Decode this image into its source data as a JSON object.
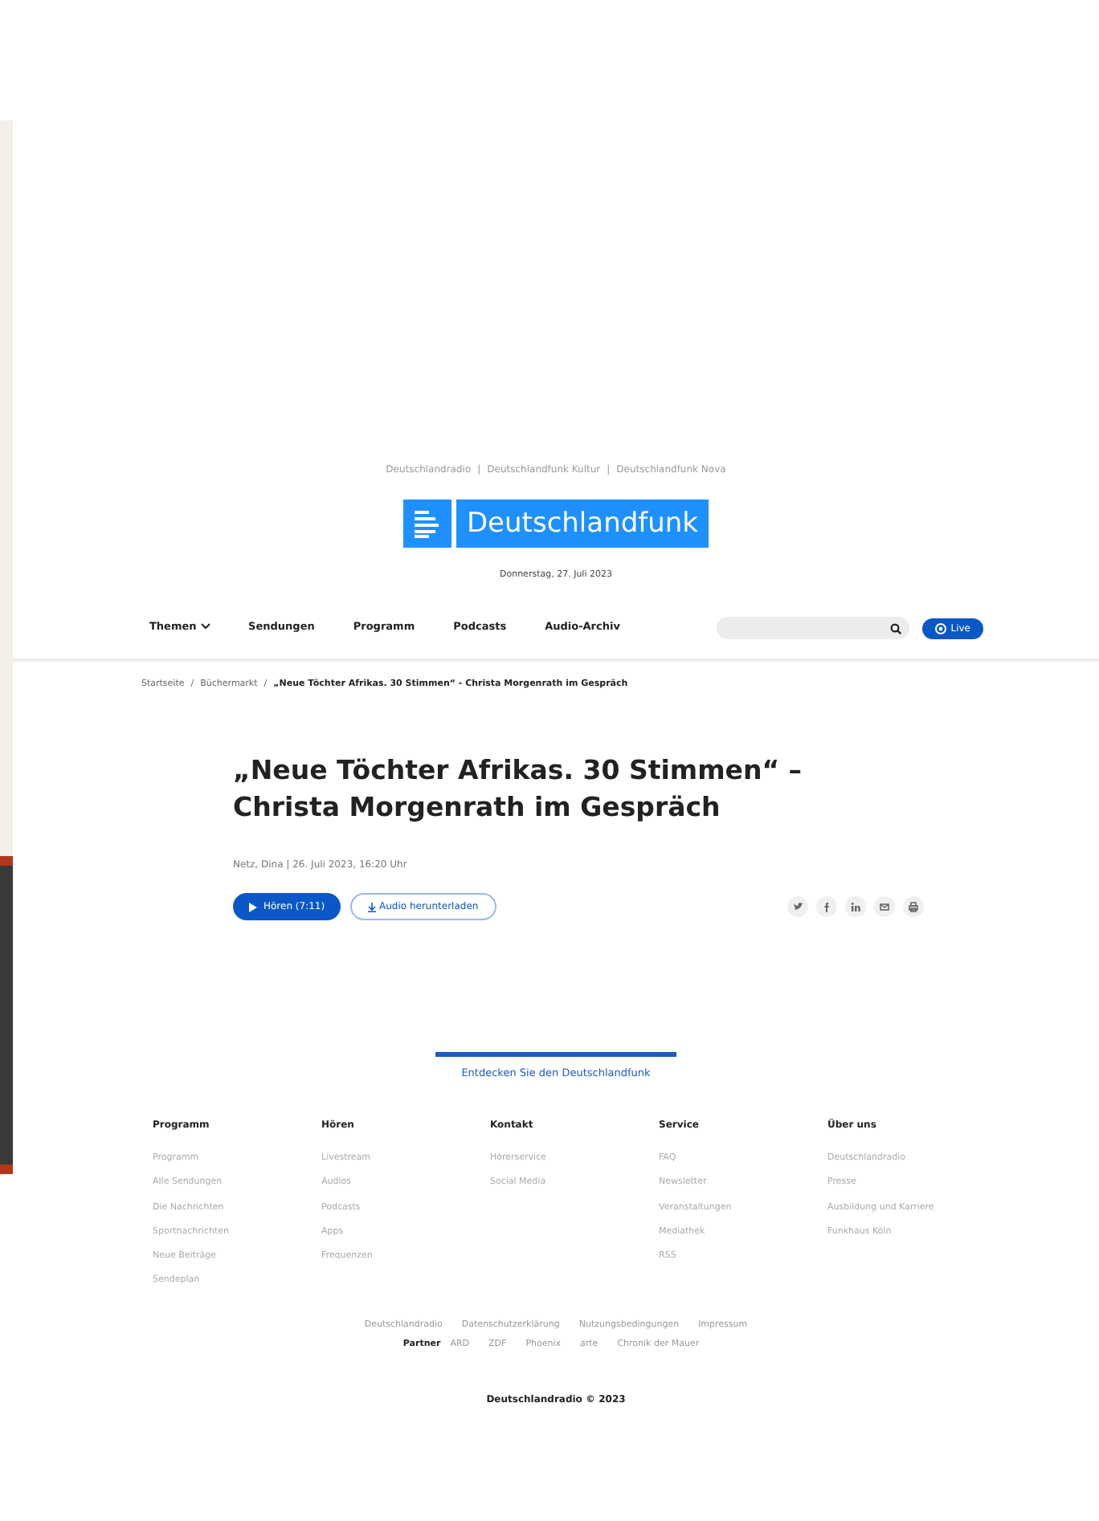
{
  "top_links": [
    {
      "label": "Deutschlandradio"
    },
    {
      "separator": "|",
      "label": "Deutschlandfunk Kultur"
    },
    {
      "separator": "|",
      "label": "Deutschlandfunk Nova"
    }
  ],
  "logo": {
    "text": "Deutschlandfunk"
  },
  "date": "Donnerstag, 27. Juli 2023",
  "nav": [
    {
      "label": "Themen",
      "dropdown": true
    },
    {
      "label": "Sendungen",
      "dropdown": false
    },
    {
      "label": "Programm",
      "dropdown": false
    },
    {
      "label": "Podcasts",
      "dropdown": false
    },
    {
      "label": "Audio-Archiv",
      "dropdown": false
    }
  ],
  "live_button": "Live",
  "breadcrumb": [
    {
      "label": "Startseite",
      "current": false
    },
    {
      "separator": "/",
      "label": "Büchermarkt",
      "current": false
    },
    {
      "separator": "/",
      "label": "„Neue Töchter Afrikas. 30 Stimmen“ - Christa Morgenrath im Gespräch",
      "current": true
    }
  ],
  "article": {
    "title": "„Neue Töchter Afrikas. 30 Stimmen“ – Christa Morgenrath im Gespräch",
    "meta": "Netz, Dina | 26. Juli 2023, 16:20 Uhr",
    "play_button": "Hören (7:11)",
    "download_button": "Audio herunterladen",
    "share": [
      {
        "kind": "twitter"
      },
      {
        "kind": "facebook"
      },
      {
        "kind": "linkedin"
      },
      {
        "kind": "mail"
      },
      {
        "kind": "print"
      }
    ]
  },
  "discover": "Entdecken Sie den Deutschlandfunk",
  "footer_columns": [
    {
      "heading": "Programm",
      "links": [
        "Programm",
        "Alle Sendungen",
        "Die Nachrichten",
        "Sportnachrichten",
        "Neue Beiträge",
        "Sendeplan"
      ]
    },
    {
      "heading": "Hören",
      "links": [
        "Livestream",
        "Audios",
        "Podcasts",
        "Apps",
        "Frequenzen"
      ]
    },
    {
      "heading": "Kontakt",
      "links": [
        "Hörerservice",
        "Social Media"
      ]
    },
    {
      "heading": "Service",
      "links": [
        "FAQ",
        "Newsletter",
        "Veranstaltungen",
        "Mediathek",
        "RSS"
      ]
    },
    {
      "heading": "Über uns",
      "links": [
        "Deutschlandradio",
        "Presse",
        "Ausbildung und Karriere",
        "Funkhaus Köln"
      ]
    }
  ],
  "legal_links": [
    "Deutschlandradio",
    "Datenschutzerklärung",
    "Nutzungsbedingungen",
    "Impressum"
  ],
  "partners": {
    "label": "Partner",
    "links": [
      "ARD",
      "ZDF",
      "Phoenix",
      "arte",
      "Chronik der Mauer"
    ]
  },
  "copyright": "Deutschlandradio © 2023"
}
